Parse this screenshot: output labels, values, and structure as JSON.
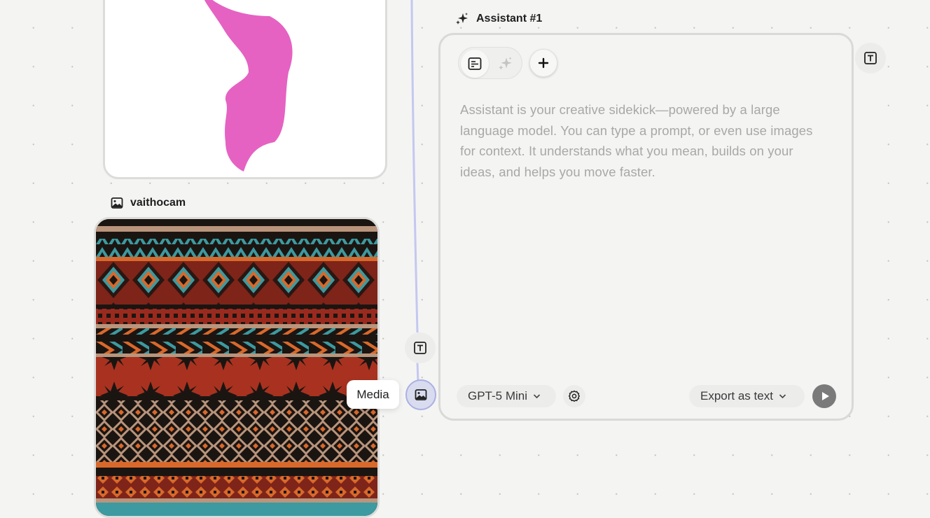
{
  "colors": {
    "canvas": "#f4f4f3",
    "accent_connector": "#aab0e3",
    "brush_pink": "#e562c3",
    "pattern_red": "#9a2a1e",
    "pattern_teal": "#3c9aa0",
    "pattern_orange": "#d9692b",
    "pattern_tan": "#b9957c"
  },
  "top_card": {
    "content": "pink brush stroke shape on white"
  },
  "media_node": {
    "label": "vaithocam",
    "icon": "image-icon"
  },
  "assistant": {
    "title": "Assistant #1",
    "title_icon": "sparkles-icon",
    "toolbar": {
      "text_mode_icon": "text-lines-icon",
      "sparkle_mode_icon": "sparkles-icon",
      "add_icon": "plus-icon"
    },
    "description": "Assistant is your creative sidekick—powered by a large language model. You can type a prompt, or even use images for context. It understands what you mean, builds on your ideas, and helps you move faster.",
    "model_label": "GPT-5 Mini",
    "settings_icon": "gear-icon",
    "export_label": "Export as text",
    "run_icon": "play-icon",
    "output_icon": "text-t-icon"
  },
  "inputs": {
    "text_input_icon": "text-t-icon",
    "media_input_icon": "image-icon",
    "media_tooltip": "Media"
  }
}
